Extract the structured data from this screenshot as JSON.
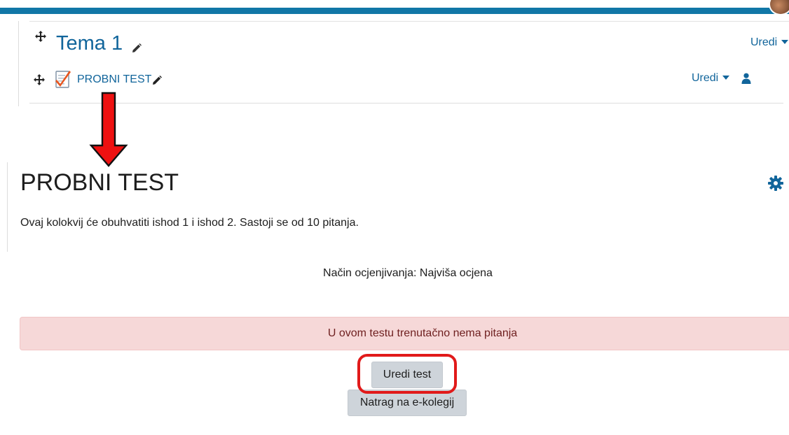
{
  "course_page": {
    "section_title": "Tema 1",
    "section_edit_menu": "Uredi",
    "activity_name": "PROBNI TEST",
    "activity_edit_menu": "Uredi"
  },
  "quiz_page": {
    "title": "PROBNI TEST",
    "intro": "Ovaj kolokvij će obuhvatiti ishod 1 i ishod 2. Sastoji se od 10 pitanja.",
    "grading_method": "Način ocjenjivanja: Najviša ocjena",
    "alert": {
      "message": "U ovom testu trenutačno nema pitanja",
      "close_glyph": "×"
    },
    "buttons": {
      "edit_quiz": "Uredi test",
      "back_to_course": "Natrag na e-kolegij"
    }
  },
  "colors": {
    "navbar": "#1177a7",
    "link": "#11659b",
    "alert_background": "#f6d8d8",
    "button_background": "#ced4da",
    "annotation_red": "#e11a1a"
  },
  "icons": {
    "move": "move-icon",
    "pencil": "pencil-icon",
    "quiz_activity": "quiz-activity-icon",
    "person": "person-icon",
    "gear": "gear-icon",
    "caret": "caret-down-icon",
    "annotation_arrow": "red-down-arrow"
  }
}
